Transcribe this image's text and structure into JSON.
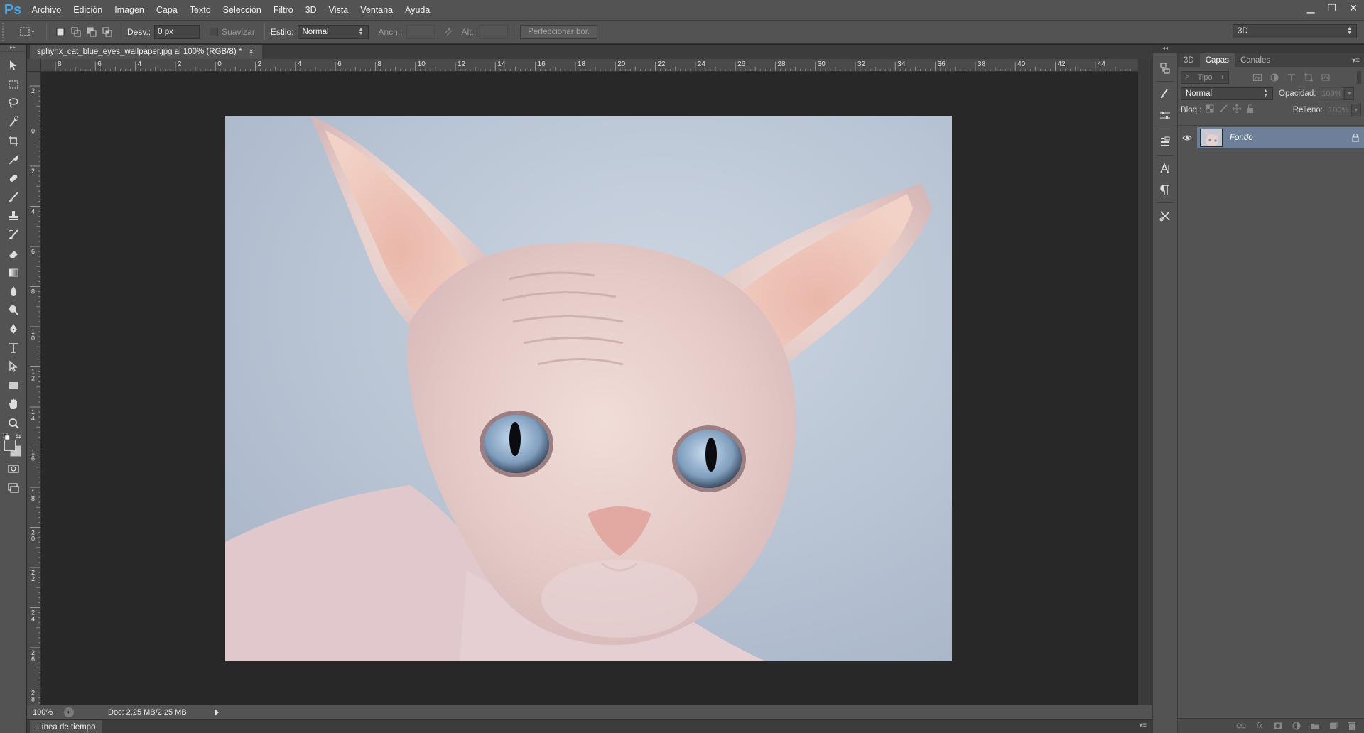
{
  "app": {
    "logo": "Ps"
  },
  "menu": [
    "Archivo",
    "Edición",
    "Imagen",
    "Capa",
    "Texto",
    "Selección",
    "Filtro",
    "3D",
    "Vista",
    "Ventana",
    "Ayuda"
  ],
  "window_controls": {
    "minimize": "▁",
    "restore": "❐",
    "close": "✕"
  },
  "options": {
    "feather_label": "Desv.:",
    "feather_value": "0 px",
    "antialias_label": "Suavizar",
    "style_label": "Estilo:",
    "style_value": "Normal",
    "width_label": "Anch.:",
    "height_label": "Alt.:",
    "refine_edge": "Perfeccionar bor.",
    "workspace": "3D"
  },
  "document": {
    "tab_title": "sphynx_cat_blue_eyes_wallpaper.jpg al 100% (RGB/8) *",
    "close": "×",
    "zoom": "100%",
    "doc_info": "Doc: 2,25 MB/2,25 MB"
  },
  "timeline": {
    "label": "Línea de tiempo"
  },
  "rulers": {
    "h_labels": [
      "8",
      "6",
      "4",
      "2",
      "0",
      "2",
      "4",
      "6",
      "8",
      "10",
      "12",
      "14",
      "16",
      "18",
      "20",
      "22",
      "24",
      "26",
      "28",
      "30",
      "32",
      "34",
      "36",
      "38",
      "40",
      "42",
      "44"
    ],
    "v_labels": [
      "2",
      "0",
      "2",
      "4",
      "6",
      "8",
      "10",
      "12",
      "14",
      "16",
      "18",
      "20",
      "22",
      "24",
      "26",
      "28"
    ]
  },
  "layers_panel": {
    "tabs": [
      "3D",
      "Capas",
      "Canales"
    ],
    "active_tab": "Capas",
    "filter_label": "Tipo",
    "blend_mode": "Normal",
    "opacity_label": "Opacidad:",
    "opacity_value": "100%",
    "lock_label": "Bloq.:",
    "fill_label": "Relleno:",
    "fill_value": "100%",
    "layers": [
      {
        "name": "Fondo",
        "visible": true,
        "locked": true
      }
    ]
  },
  "colors": {
    "accent": "#3aa7f0",
    "selected_layer": "#6e7f99"
  }
}
